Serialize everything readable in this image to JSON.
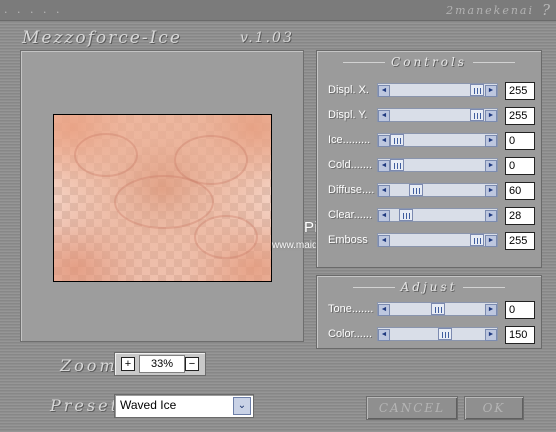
{
  "titlebar": {
    "dots": "· · · · ·",
    "brand": "2manekenai",
    "help_glyph": "?"
  },
  "plugin": {
    "title": "Mezzoforce-Ice",
    "version": "v.1.03"
  },
  "watermark": {
    "main": "Pinuccia",
    "sub": "www.maidiregrafica.eu"
  },
  "controls": {
    "title": "Controls",
    "sliders": [
      {
        "label": "Displ. X.",
        "value": "255",
        "fraction": 0.99
      },
      {
        "label": "Displ. Y.",
        "value": "255",
        "fraction": 0.99
      },
      {
        "label": "Ice.........",
        "value": "0",
        "fraction": 0.0
      },
      {
        "label": "Cold.......",
        "value": "0",
        "fraction": 0.0
      },
      {
        "label": "Diffuse....",
        "value": "60",
        "fraction": 0.24
      },
      {
        "label": "Clear......",
        "value": "28",
        "fraction": 0.11
      },
      {
        "label": "Emboss",
        "value": "255",
        "fraction": 0.99
      }
    ]
  },
  "adjust": {
    "title": "Adjust",
    "sliders": [
      {
        "label": "Tone.......",
        "value": "0",
        "fraction": 0.5
      },
      {
        "label": "Color......",
        "value": "150",
        "fraction": 0.59
      }
    ]
  },
  "zoom": {
    "label": "Zoom",
    "value": "33%",
    "plus_label": "+",
    "minus_label": "−"
  },
  "preset": {
    "label": "Preset",
    "value": "Waved Ice",
    "arrow": "⌄"
  },
  "buttons": {
    "cancel": "CANCEL",
    "ok": "OK"
  }
}
